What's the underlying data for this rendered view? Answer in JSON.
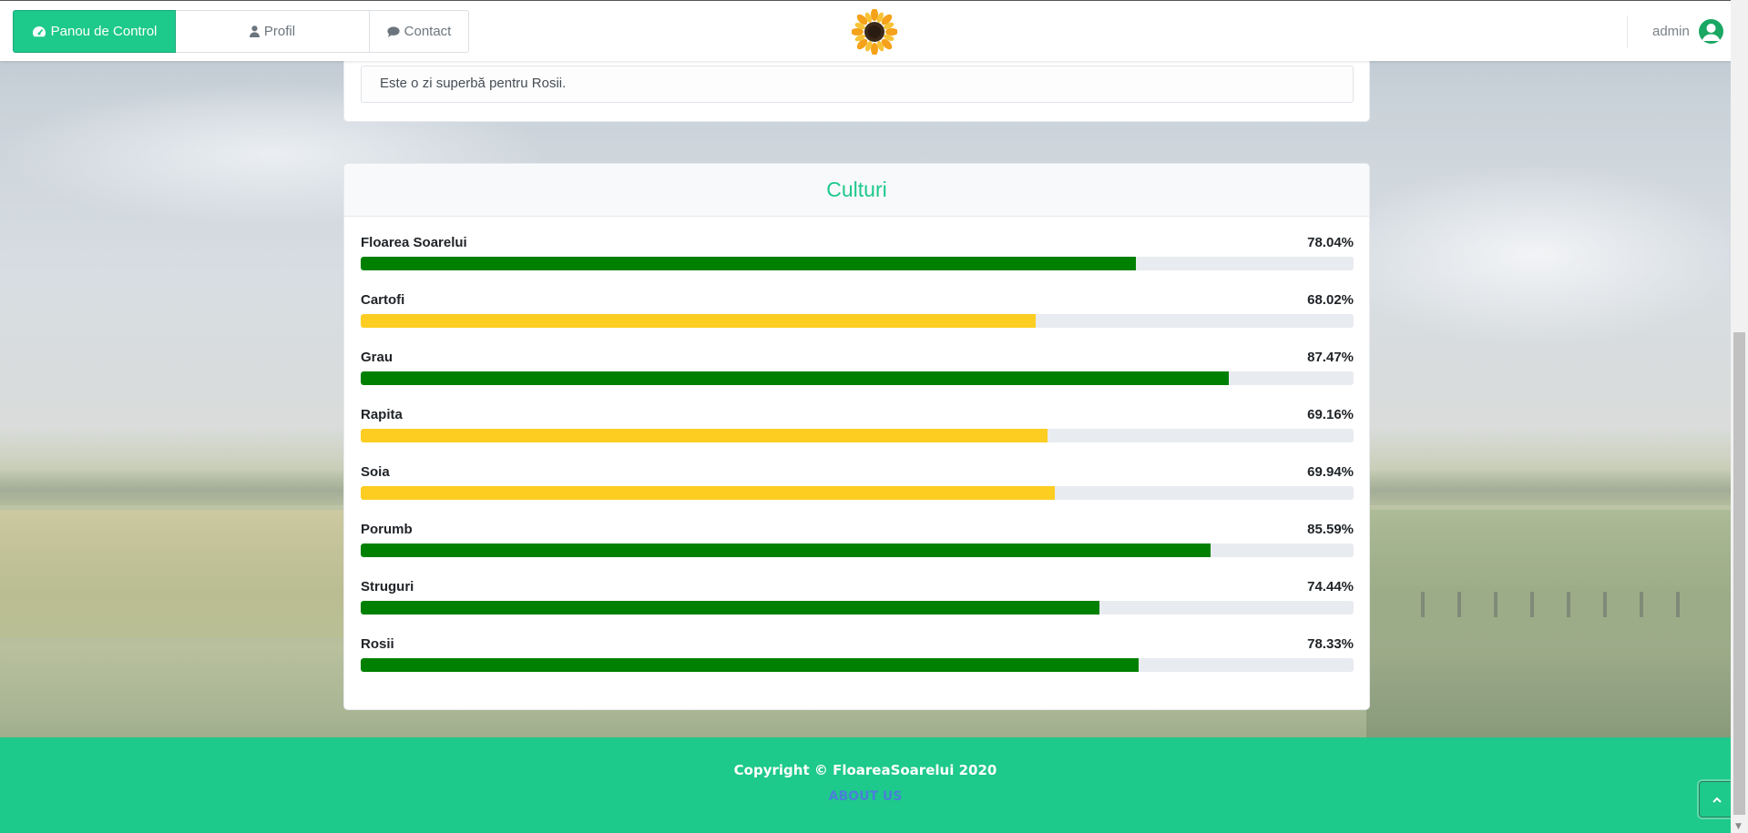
{
  "nav": {
    "tabs": [
      {
        "label": "Panou de Control",
        "icon": "dashboard-icon",
        "active": true
      },
      {
        "label": "Profil",
        "icon": "user-icon",
        "active": false
      },
      {
        "label": "Contact",
        "icon": "comment-icon",
        "active": false
      }
    ],
    "logo": "sunflower-logo",
    "user": {
      "name": "admin",
      "icon": "user-circle-icon"
    }
  },
  "weather": {
    "message": "Este o zi superbă pentru Rosii."
  },
  "crops": {
    "title": "Culturi",
    "items": [
      {
        "name": "Floarea Soarelui",
        "percent_label": "78.04%",
        "value": 78.04,
        "status": "good"
      },
      {
        "name": "Cartofi",
        "percent_label": "68.02%",
        "value": 68.02,
        "status": "warning"
      },
      {
        "name": "Grau",
        "percent_label": "87.47%",
        "value": 87.47,
        "status": "good"
      },
      {
        "name": "Rapita",
        "percent_label": "69.16%",
        "value": 69.16,
        "status": "warning"
      },
      {
        "name": "Soia",
        "percent_label": "69.94%",
        "value": 69.94,
        "status": "warning"
      },
      {
        "name": "Porumb",
        "percent_label": "85.59%",
        "value": 85.59,
        "status": "good"
      },
      {
        "name": "Struguri",
        "percent_label": "74.44%",
        "value": 74.44,
        "status": "good"
      },
      {
        "name": "Rosii",
        "percent_label": "78.33%",
        "value": 78.33,
        "status": "good"
      }
    ]
  },
  "footer": {
    "copyright": "Copyright © FloareaSoarelui 2020",
    "about": "ABOUT US"
  },
  "colors": {
    "accent": "#1dc98b",
    "good": "#008000",
    "warning": "#fdcd22",
    "track": "#e8ebf0"
  }
}
